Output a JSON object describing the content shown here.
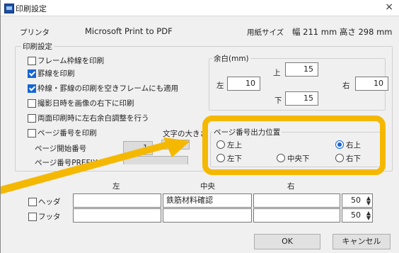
{
  "window": {
    "title": "印刷設定",
    "close": "×"
  },
  "header": {
    "printer_label": "プリンタ",
    "printer_name": "Microsoft Print to PDF",
    "paper_label": "用紙サイズ",
    "paper_size": "幅  211 mm 高さ 298 mm"
  },
  "settings": {
    "group_label": "印刷設定",
    "options": [
      {
        "label": "フレーム枠線を印刷",
        "checked": false
      },
      {
        "label": "罫線を印刷",
        "checked": true
      },
      {
        "label": "枠線・罫線の印刷を空きフレームにも適用",
        "checked": true
      },
      {
        "label": "撮影日時を画像の右下に印刷",
        "checked": false
      },
      {
        "label": "両面印刷時に左右余白調整を行う",
        "checked": false
      },
      {
        "label": "ページ番号を印刷",
        "checked": false
      }
    ],
    "page_start_label": "ページ開始番号",
    "page_start_value": "1",
    "prefix_label": "ページ番号PREFIX",
    "font_size_label": "文字の大きさ"
  },
  "margin": {
    "group_label": "余白(mm)",
    "top_label": "上",
    "top_value": "15",
    "left_label": "左",
    "left_value": "10",
    "right_label": "右",
    "right_value": "10",
    "bottom_label": "下",
    "bottom_value": "15"
  },
  "page_position": {
    "group_label": "ページ番号出力位置",
    "options": [
      {
        "label": "左上",
        "selected": false
      },
      {
        "label": "右上",
        "selected": true
      },
      {
        "label": "左下",
        "selected": false
      },
      {
        "label": "中央下",
        "selected": false
      },
      {
        "label": "右下",
        "selected": false
      }
    ]
  },
  "header_footer": {
    "col_left": "左",
    "col_center": "中央",
    "col_right": "右",
    "header_label": "ヘッダ",
    "footer_label": "フッタ",
    "header_center_value": "鉄筋材料確認",
    "header_size": "50",
    "footer_size": "50"
  },
  "buttons": {
    "ok": "OK",
    "cancel": "キャンセル"
  },
  "colors": {
    "highlight": "#f5b800",
    "accent": "#1565d8"
  }
}
